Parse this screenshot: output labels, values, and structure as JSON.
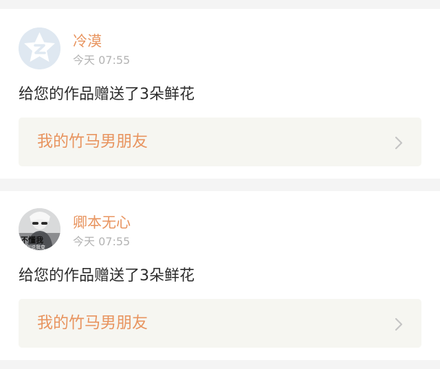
{
  "feed": [
    {
      "user": "冷漠",
      "time": "今天 07:55",
      "message": "给您的作品赠送了3朵鲜花",
      "work_title": "我的竹马男朋友",
      "avatar": "default-qq-avatar-icon"
    },
    {
      "user": "卿本无心",
      "time": "今天 07:55",
      "message": "给您的作品赠送了3朵鲜花",
      "work_title": "我的竹马男朋友",
      "avatar": "photo-avatar",
      "avatar_text": "不懂我 就别说我变"
    }
  ],
  "colors": {
    "username": "#e8945f",
    "work_title": "#e8945f",
    "time": "#b3b3b3",
    "message": "#2b2b2b",
    "link_bg": "#f6f6f1",
    "page_bg": "#f4f4f4"
  }
}
